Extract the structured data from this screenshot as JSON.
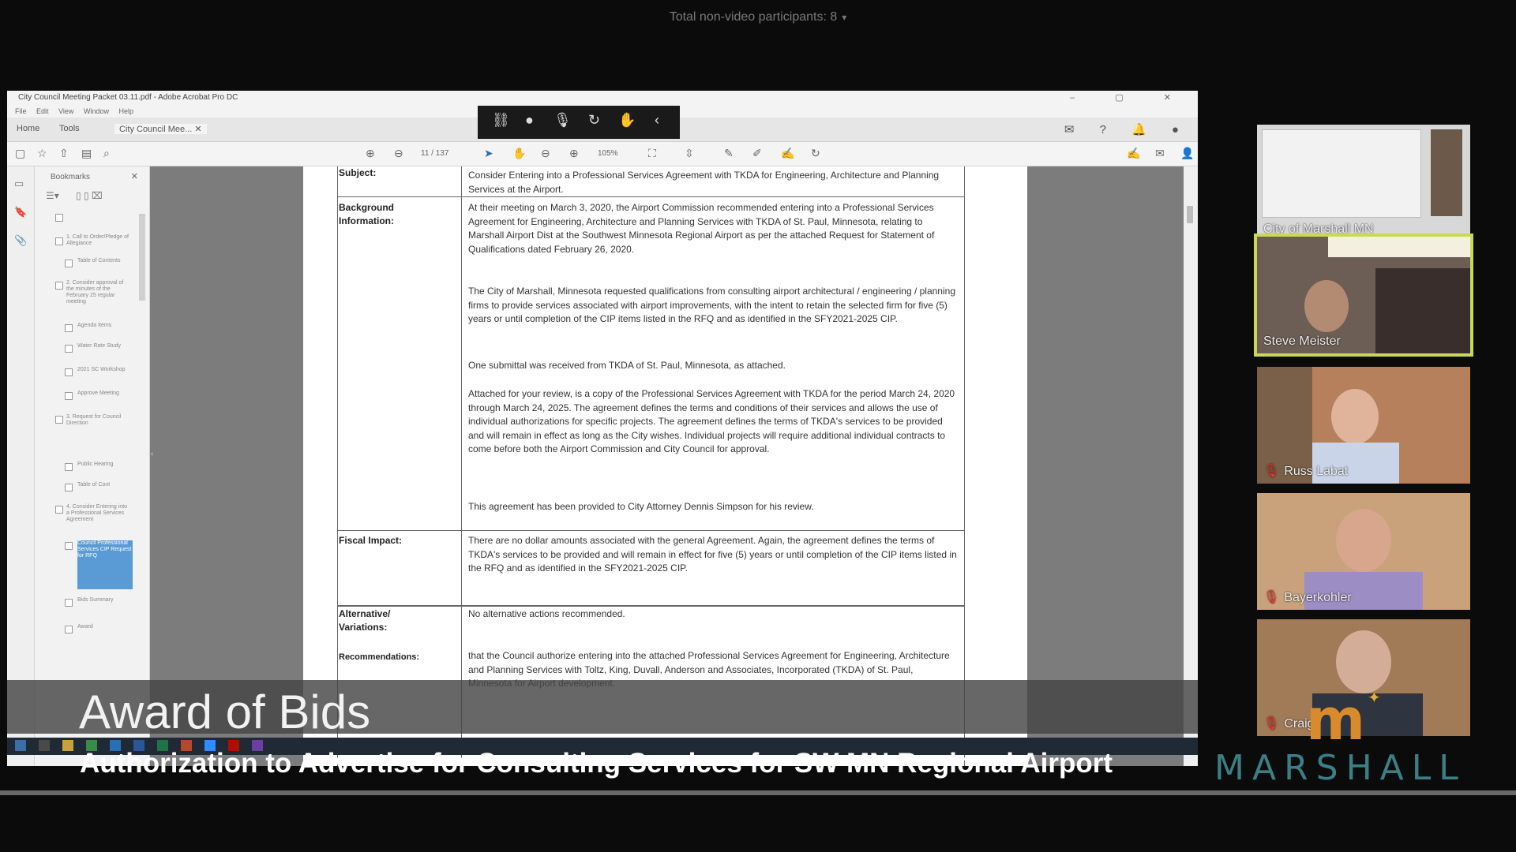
{
  "top_bar": {
    "participants": "Total non-video participants: 8",
    "chevron": "▾"
  },
  "shared_window": {
    "title": "City Council Meeting Packet 03.11.pdf - Adobe Acrobat Pro DC",
    "window_controls": "– ▢ ✕",
    "menu": [
      "File",
      "Edit",
      "View",
      "Window",
      "Help"
    ],
    "tabs": [
      "Home",
      "Tools",
      "City Council Mee... ✕"
    ],
    "page_indicator": "11 / 137",
    "zoom": "105%",
    "bookmarks_title": "Bookmarks",
    "bookmarks": [
      "1. Call to Order/Pledge of Allegiance",
      "Table of Contents",
      "2. Consider approval of the minutes of the February 25 regular meeting",
      "Agenda Items",
      "Water Rate Study",
      "2021 SC Workshop",
      "Approve Meeting",
      "3. Request for Council Direction",
      "Public Hearing",
      "Table of Cont",
      "4. Consider Entering into a Professional Services Agreement",
      "Council Professional Services CIP Request",
      "Bids Summary",
      "Award"
    ],
    "selected_bookmark": "Council Professional Services CIP Request for RFQ"
  },
  "document": {
    "subject_label": "Subject:",
    "subject": "Consider Entering into a Professional Services Agreement with TKDA for Engineering, Architecture and Planning Services at the Airport.",
    "background_label": "Background Information:",
    "background": [
      "At their meeting on March 3, 2020, the Airport Commission recommended entering into a Professional Services Agreement for Engineering, Architecture and Planning Services with TKDA of St. Paul, Minnesota, relating to Marshall Airport Dist at the Southwest Minnesota Regional Airport as per the attached Request for Statement of Qualifications dated February 26, 2020.",
      "The City of Marshall, Minnesota requested qualifications from consulting airport architectural / engineering / planning firms to provide services associated with airport improvements, with the intent to retain the selected firm for five (5) years or until completion of the CIP items listed in the RFQ and as identified in the SFY2021-2025 CIP.",
      "One submittal was received from TKDA of St. Paul, Minnesota, as attached.",
      "Attached for your review, is a copy of the Professional Services Agreement with TKDA for the period March 24, 2020 through March 24, 2025. The agreement defines the terms and conditions of their services and allows the use of individual authorizations for specific projects. The agreement defines the terms of TKDA's services to be provided and will remain in effect as long as the City wishes. Individual projects will require additional individual contracts to come before both the Airport Commission and City Council for approval.",
      "This agreement has been provided to City Attorney Dennis Simpson for his review."
    ],
    "fiscal_label": "Fiscal Impact:",
    "fiscal": "There are no dollar amounts associated with the general Agreement. Again, the agreement defines the terms of TKDA's services to be provided and will remain in effect for five (5) years or until completion of the CIP items listed in the RFQ and as identified in the SFY2021-2025 CIP.",
    "alternatives_label": "Alternative/ Variations:",
    "alternatives": "No alternative actions recommended.",
    "recommendations_label": "Recommendations:",
    "recommendations": "that the Council authorize entering into the attached Professional Services Agreement for Engineering, Architecture and Planning Services with Toltz, King, Duvall, Anderson and Associates, Incorporated (TKDA) of St. Paul, Minnesota for Airport development."
  },
  "lower_third": {
    "title": "Award of Bids",
    "subtitle": "Authorization to Advertise for Consulting Services for SW MN Regional Airport"
  },
  "participants": [
    {
      "name": "City of Marshall MN"
    },
    {
      "name": "Steve Meister"
    },
    {
      "name": "Russ Labat"
    },
    {
      "name": "Bayerkohler"
    },
    {
      "name": "Craig"
    }
  ],
  "logo": {
    "mark": "m",
    "text": "MARSHALL"
  },
  "colors": {
    "active_speaker": "#c8d95a",
    "logo_orange": "#d98a2a",
    "logo_teal": "#3b7f86",
    "selection_blue": "#5b9bd5"
  }
}
